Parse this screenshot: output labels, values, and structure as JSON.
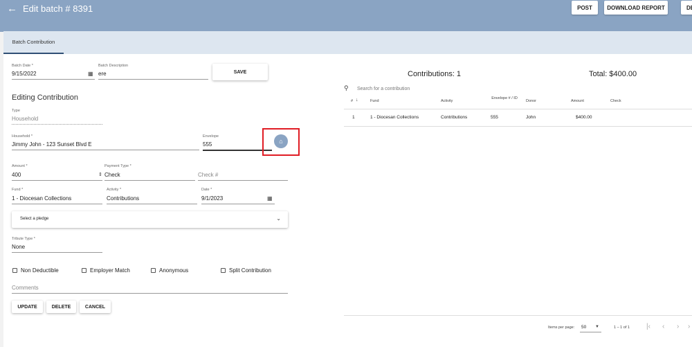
{
  "topbar": {
    "back_icon": "arrow-left-icon",
    "title": "Edit batch # 8391",
    "post_label": "POST",
    "download_label": "DOWNLOAD REPORT",
    "cut_label": "DE"
  },
  "tabs": [
    {
      "label": "Batch Contribution"
    }
  ],
  "batch": {
    "date_label": "Batch Date *",
    "date_value": "9/15/2022",
    "desc_label": "Batch Description",
    "desc_value": "ere",
    "save_label": "SAVE"
  },
  "form": {
    "heading": "Editing Contribution",
    "type_label": "Type",
    "type_value": "Household",
    "household_label": "Household *",
    "household_value": "Jimmy John - 123 Sunset Blvd E",
    "envelope_label": "Envelope",
    "envelope_value": "555",
    "home_icon": "home-icon",
    "amount_label": "Amount *",
    "amount_value": "400",
    "payment_type_label": "Payment Type *",
    "payment_type_value": "Check",
    "check_placeholder": "Check #",
    "fund_label": "Fund *",
    "fund_value": "1 - Diocesan Collections",
    "activity_label": "Activity *",
    "activity_value": "Contributions",
    "date_label": "Date *",
    "date_value": "9/1/2023",
    "pledge_placeholder": "Select a pledge",
    "tribute_label": "Tribute Type *",
    "tribute_value": "None",
    "checkboxes": [
      {
        "label": "Non Deductible"
      },
      {
        "label": "Employer Match"
      },
      {
        "label": "Anonymous"
      },
      {
        "label": "Split Contribution"
      }
    ],
    "comments_placeholder": "Comments",
    "update_label": "UPDATE",
    "delete_label": "DELETE",
    "cancel_label": "CANCEL"
  },
  "summary": {
    "contributions": "Contributions: 1",
    "total": "Total: $400.00",
    "search_placeholder": "Search for a contribution"
  },
  "table": {
    "headers": [
      "#",
      "Fund",
      "Activity",
      "Envelope # / ID",
      "Donor",
      "Amount",
      "Check"
    ],
    "rows": [
      [
        "1",
        "1 - Diocesan Collections",
        "Contributions",
        "555",
        "John",
        "$400.00",
        ""
      ]
    ]
  },
  "pagination": {
    "items_label": "Items per page:",
    "items_value": "50",
    "range": "1 – 1 of 1"
  },
  "colors": {
    "header": "#8aa4c3",
    "tabstrip": "#dde6f0",
    "highlight": "#e01c24"
  }
}
